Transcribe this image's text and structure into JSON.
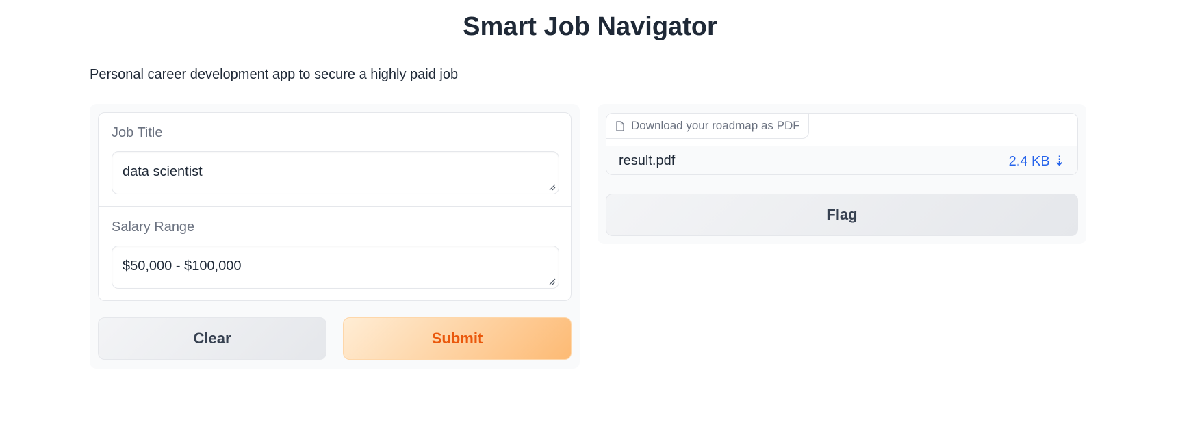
{
  "header": {
    "title": "Smart Job Navigator",
    "description": "Personal career development app to secure a highly paid job"
  },
  "form": {
    "job_title": {
      "label": "Job Title",
      "value": "data scientist"
    },
    "salary_range": {
      "label": "Salary Range",
      "value": "$50,000 - $100,000"
    }
  },
  "actions": {
    "clear_label": "Clear",
    "submit_label": "Submit",
    "flag_label": "Flag"
  },
  "output": {
    "label": "Download your roadmap as PDF",
    "file_name": "result.pdf",
    "file_size": "2.4 KB ⇣",
    "file_icon": "file-icon"
  },
  "colors": {
    "submit_text": "#ea580c",
    "submit_bg": "#fdba74",
    "link": "#2563eb"
  }
}
